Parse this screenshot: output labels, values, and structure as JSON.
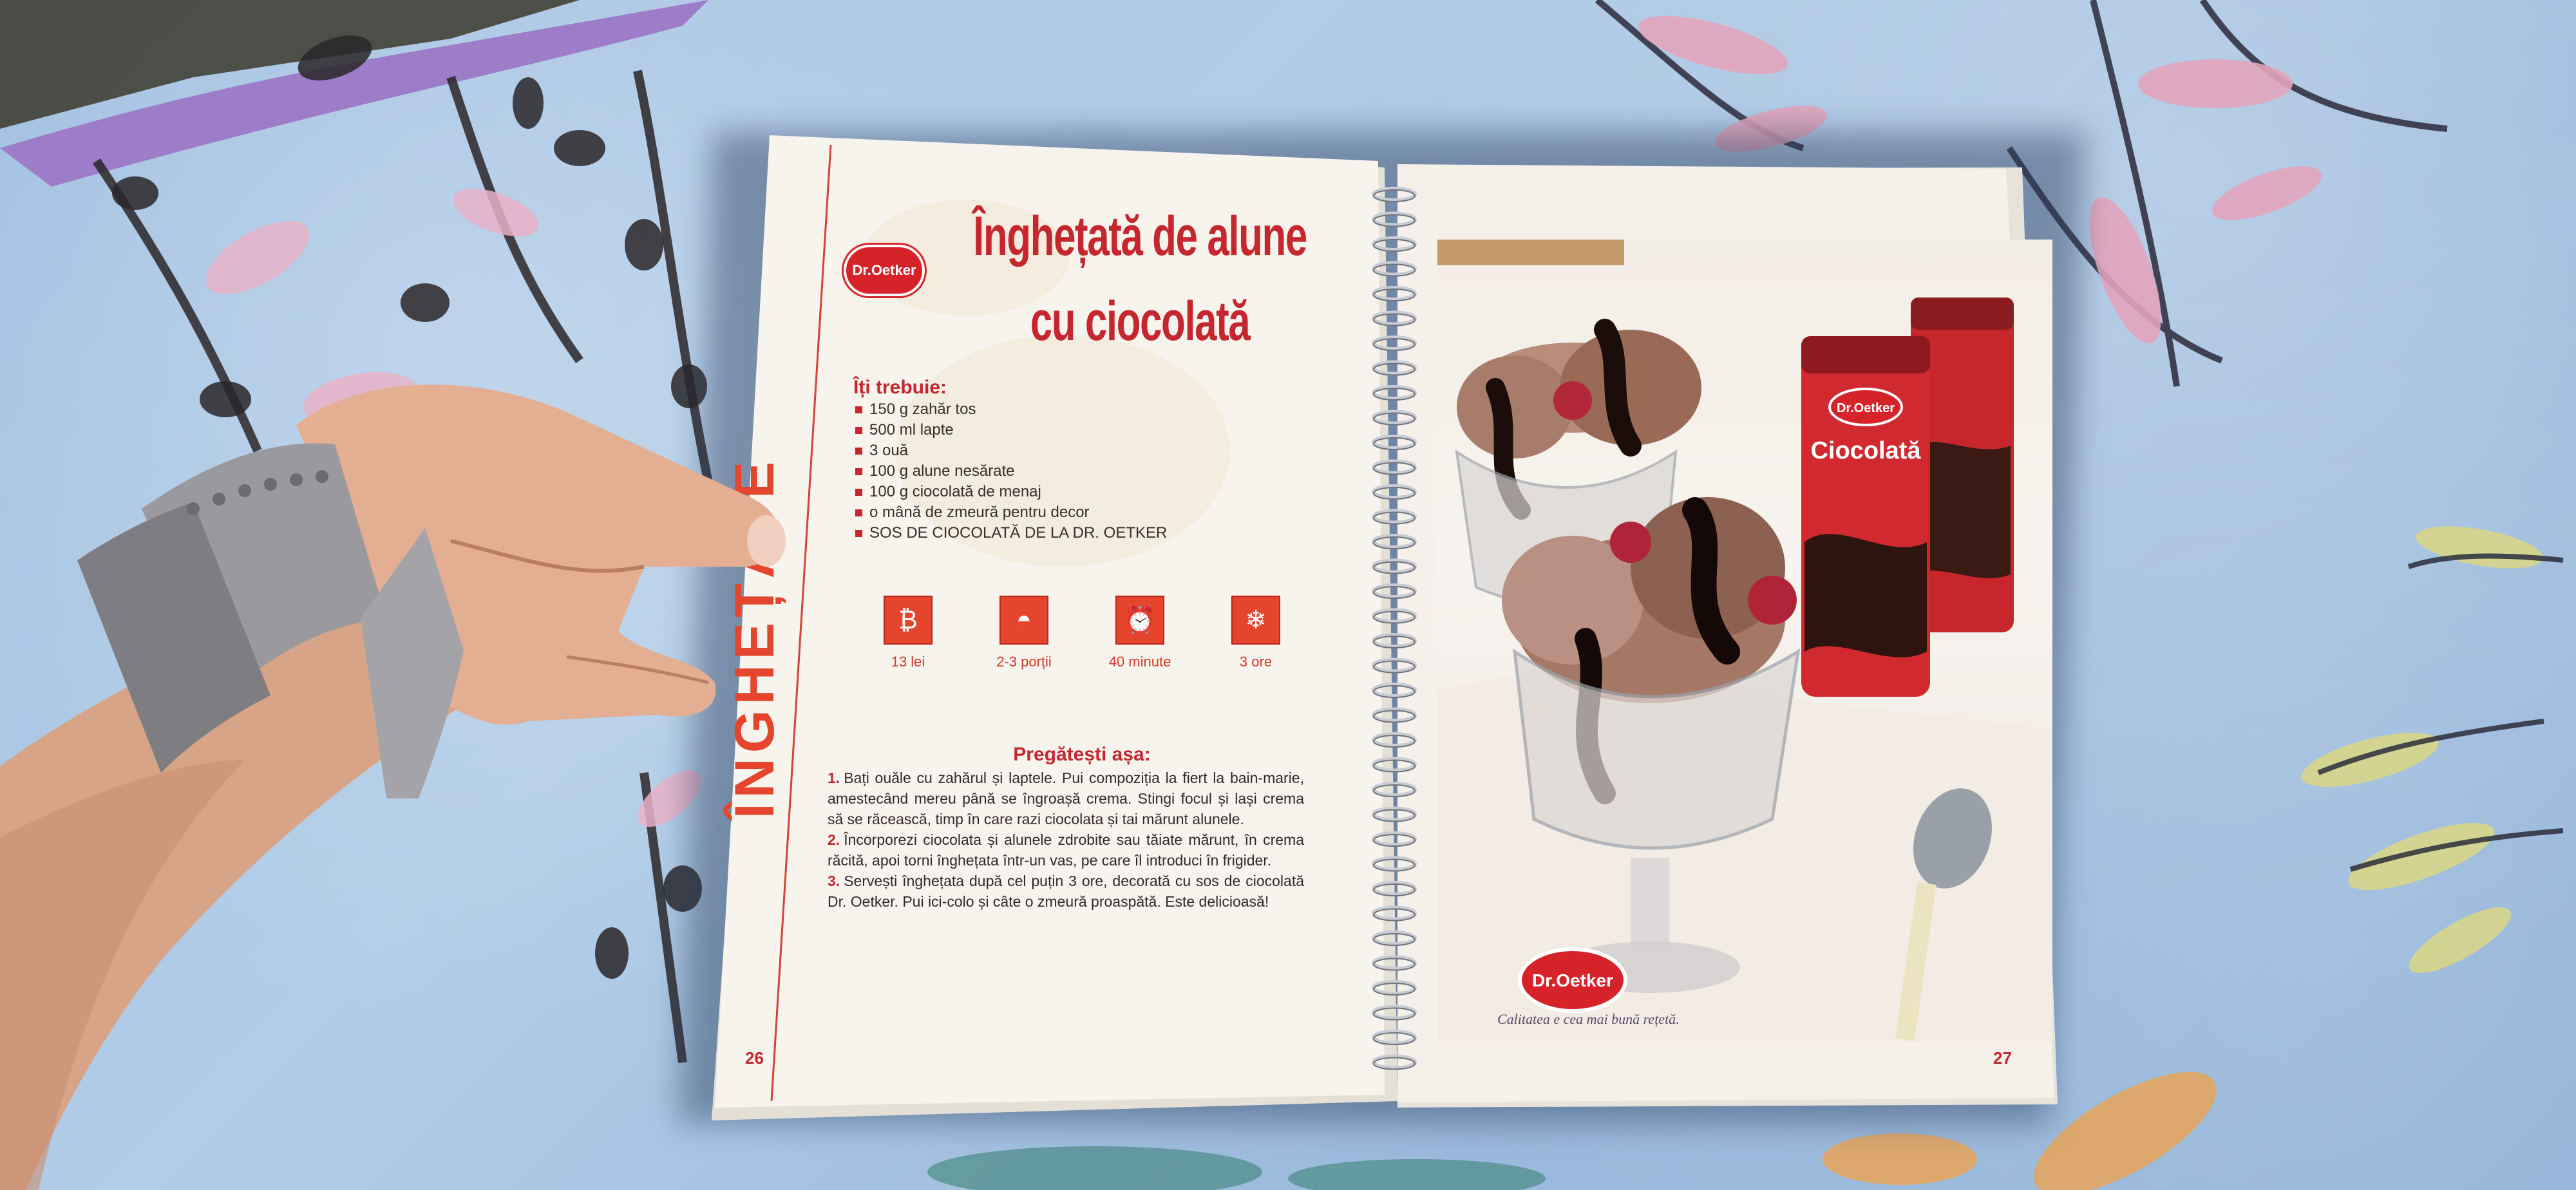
{
  "left_page": {
    "title_line1": "Înghețată de alune",
    "title_line2": "cu ciocolată",
    "brand": "Dr.Oetker",
    "ingredients_heading": "Îți trebuie:",
    "ingredients": [
      "150 g zahăr tos",
      "500 ml lapte",
      "3 ouă",
      "100 g alune nesărate",
      "100 g ciocolată de menaj",
      "o mână de zmeură pentru decor",
      "SOS DE CIOCOLATĂ DE LA DR. OETKER"
    ],
    "badges": [
      {
        "icon": "piggy-bank-icon",
        "glyph": "₿",
        "label": "13 lei"
      },
      {
        "icon": "bowl-icon",
        "glyph": "◓",
        "label": "2-3  porții"
      },
      {
        "icon": "alarm-clock-icon",
        "glyph": "⏰",
        "label": "40 minute"
      },
      {
        "icon": "snowflake-icon",
        "glyph": "❄",
        "label": "3 ore"
      }
    ],
    "preparation_heading": "Pregătești așa:",
    "steps": [
      {
        "number": "1.",
        "text": "Bați ouăle cu zahărul și laptele. Pui compoziția la fiert la bain-marie, amestecând mereu până se îngroașă crema. Stingi focul și lași crema să se răcească, timp în care razi ciocolata și tai mărunt alunele."
      },
      {
        "number": "2.",
        "text": "Încorporezi ciocolata și alunele zdrobite sau tăiate mărunt, în crema răcită, apoi torni înghețata într-un vas, pe care îl introduci în frigider."
      },
      {
        "number": "3.",
        "text": "Servești înghețata după cel puțin 3 ore, decorată cu sos de ciocolată Dr. Oetker. Pui ici-colo și câte o zmeură proaspătă. Este delicioasă!"
      }
    ],
    "section_label": "ÎNGHEȚATE",
    "page_number": "26"
  },
  "right_page": {
    "brand": "Dr.Oetker",
    "product_label": "Ciocolată",
    "caption": "Calitatea e cea mai bună rețetă.",
    "page_number": "27"
  },
  "colors": {
    "brand_red": "#c6262e",
    "badge_orange": "#e4452c",
    "fabric_blue": "#9ebde0"
  }
}
